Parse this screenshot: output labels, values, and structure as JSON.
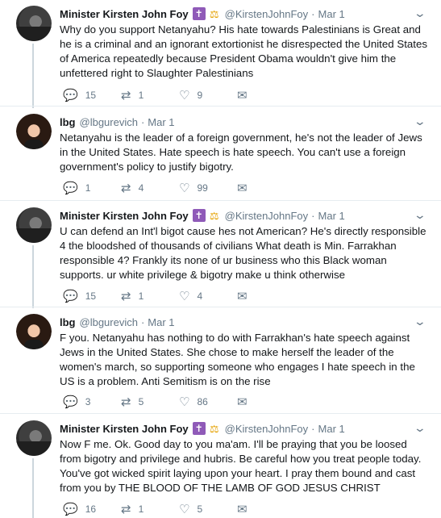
{
  "tweets": [
    {
      "author": "Minister Kirsten John Foy",
      "handle": "@KirstenJohnFoy",
      "date": "Mar 1",
      "text": "Why do you support Netanyahu? His hate towards Palestinians is Great and he is a criminal and an ignorant extortionist he disrespected the United States of America repeatedly because President Obama wouldn't give him the unfettered right to Slaughter Palestinians",
      "replies": "15",
      "retweets": "1",
      "likes": "9"
    },
    {
      "author": "lbg",
      "handle": "@lbgurevich",
      "date": "Mar 1",
      "text": "Netanyahu is the leader of a foreign government, he's not the leader of Jews in the United States. Hate speech is hate speech. You can't use a foreign government's policy to justify bigotry.",
      "replies": "1",
      "retweets": "4",
      "likes": "99"
    },
    {
      "author": "Minister Kirsten John Foy",
      "handle": "@KirstenJohnFoy",
      "date": "Mar 1",
      "text": "U can defend an Int'l bigot cause hes not American? He's directly responsible 4 the bloodshed of thousands of civilians What death is Min. Farrakhan responsible 4? Frankly its none of ur business who this Black woman supports. ur white privilege & bigotry make u think otherwise",
      "replies": "15",
      "retweets": "1",
      "likes": "4"
    },
    {
      "author": "lbg",
      "handle": "@lbgurevich",
      "date": "Mar 1",
      "text": "F you. Netanyahu has nothing to do with Farrakhan's hate speech against Jews in the United States. She chose to make herself the leader of the women's march, so supporting someone who engages I hate speech in the US is a problem. Anti Semitism is on the rise",
      "replies": "3",
      "retweets": "5",
      "likes": "86"
    },
    {
      "author": "Minister Kirsten John Foy",
      "handle": "@KirstenJohnFoy",
      "date": "Mar 1",
      "text": "Now F me. Ok. Good day to you ma'am. I'll be praying that you be loosed from bigotry and privilege and hubris. Be careful how you treat people today. You've got wicked spirit laying upon your heart. I pray them bound and cast from you by THE BLOOD OF THE LAMB OF GOD JESUS CHRIST",
      "replies": "16",
      "retweets": "1",
      "likes": "5"
    }
  ],
  "badges": {
    "cross": "✝",
    "scales": "⚖"
  },
  "icons": {
    "reply": "reply-icon",
    "retweet": "retweet-icon",
    "like": "heart-icon",
    "dm": "envelope-icon",
    "more": "chevron-down-icon"
  },
  "glyphs": {
    "dot": "·",
    "chevron": "⌄",
    "reply": "💬",
    "retweet": "⇄",
    "like": "♡",
    "dm": "✉"
  },
  "colors": {
    "accent_badge": "#8f5ab8",
    "scales": "#e5a100",
    "muted": "#657786",
    "border": "#e6ecf0"
  }
}
